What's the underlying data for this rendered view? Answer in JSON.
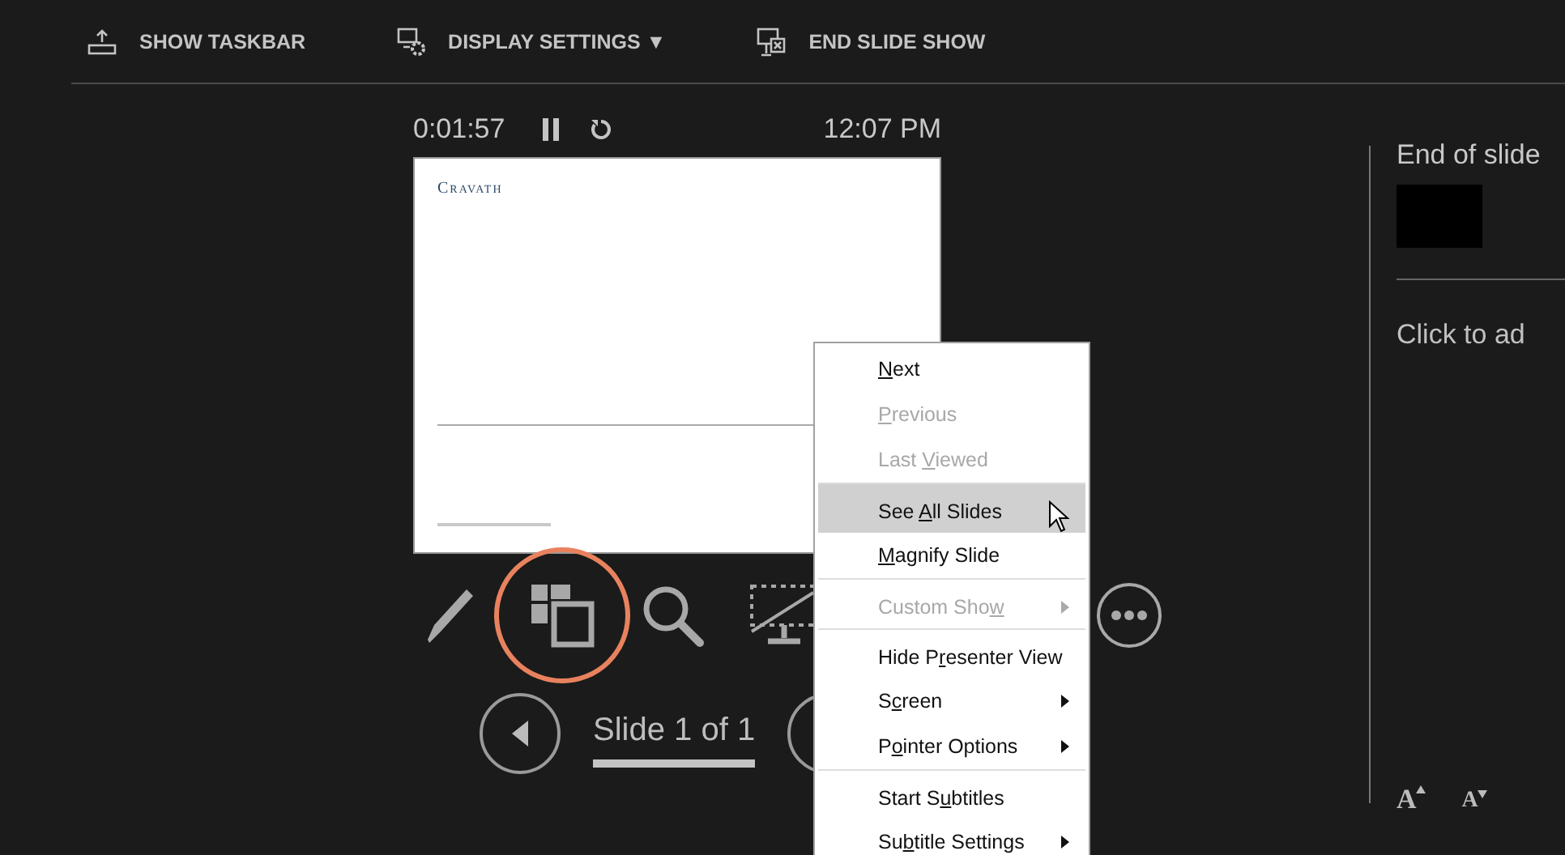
{
  "toolbar": [
    {
      "kind": "taskbar",
      "label": "SHOW TASKBAR"
    },
    {
      "kind": "display",
      "label": "DISPLAY SETTINGS ▼"
    },
    {
      "kind": "end",
      "label": "END SLIDE SHOW"
    }
  ],
  "timer": {
    "elapsed": "0:01:57",
    "clock": "12:07 PM"
  },
  "slide": {
    "logo": "Cravath"
  },
  "tools": [
    {
      "kind": "pen",
      "highlighted": false
    },
    {
      "kind": "slides",
      "highlighted": true
    },
    {
      "kind": "zoom",
      "highlighted": false
    },
    {
      "kind": "pointer",
      "highlighted": false
    },
    {
      "kind": "more",
      "highlighted": false
    }
  ],
  "navigation": {
    "counter": "Slide 1 of 1"
  },
  "next_panel": {
    "title": "End of slide",
    "notes": "Click to ad"
  },
  "font_buttons": [
    {
      "kind": "up",
      "label": "A"
    },
    {
      "kind": "down",
      "label": "A"
    }
  ],
  "context_menu": [
    {
      "key": "N",
      "after": "ext",
      "disabled": false,
      "selected": false,
      "submenu": false,
      "separator_before": false
    },
    {
      "key": "P",
      "after": "revious",
      "disabled": true,
      "selected": false,
      "submenu": false,
      "separator_before": false
    },
    {
      "before": "Last ",
      "key": "V",
      "after": "iewed",
      "disabled": true,
      "selected": false,
      "submenu": false,
      "separator_before": false
    },
    {
      "before": "See ",
      "key": "A",
      "after": "ll Slides",
      "disabled": false,
      "selected": true,
      "submenu": false,
      "separator_before": true
    },
    {
      "key": "M",
      "after": "agnify Slide",
      "disabled": false,
      "selected": false,
      "submenu": false,
      "separator_before": false
    },
    {
      "before": "Custom Sho",
      "key": "w",
      "disabled": true,
      "selected": false,
      "submenu": true,
      "separator_before": true
    },
    {
      "before": "Hide P",
      "key": "r",
      "after": "esenter View",
      "disabled": false,
      "selected": false,
      "submenu": false,
      "separator_before": true
    },
    {
      "before": "S",
      "key": "c",
      "after": "reen",
      "disabled": false,
      "selected": false,
      "submenu": true,
      "separator_before": false
    },
    {
      "before": "P",
      "key": "o",
      "after": "inter Options",
      "disabled": false,
      "selected": false,
      "submenu": true,
      "separator_before": false
    },
    {
      "before": "Start S",
      "key": "u",
      "after": "btitles",
      "disabled": false,
      "selected": false,
      "submenu": false,
      "separator_before": true
    },
    {
      "before": "Su",
      "key": "b",
      "after": "title Settings",
      "disabled": false,
      "selected": false,
      "submenu": true,
      "separator_before": false
    }
  ]
}
